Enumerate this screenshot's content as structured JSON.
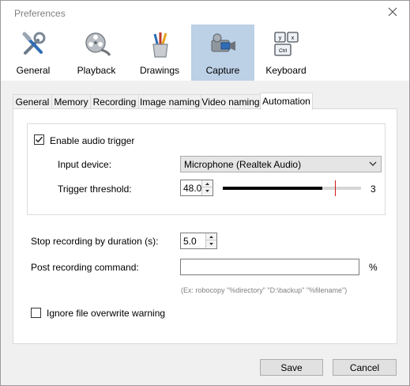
{
  "window": {
    "title": "Preferences"
  },
  "toolbar": {
    "items": [
      {
        "label": "General",
        "icon": "tools-icon"
      },
      {
        "label": "Playback",
        "icon": "film-reel-icon"
      },
      {
        "label": "Drawings",
        "icon": "pencil-cup-icon"
      },
      {
        "label": "Capture",
        "icon": "video-camera-icon",
        "active": true
      },
      {
        "label": "Keyboard",
        "icon": "keyboard-keys-icon"
      }
    ],
    "keys": {
      "k1": "y",
      "k2": "x",
      "k3": "Ctrl"
    }
  },
  "tabs": [
    "General",
    "Memory",
    "Recording",
    "Image naming",
    "Video naming",
    "Automation"
  ],
  "active_tab": "Automation",
  "automation": {
    "enable_audio_trigger": {
      "label": "Enable audio trigger",
      "checked": true
    },
    "input_device": {
      "label": "Input device:",
      "value": "Microphone (Realtek Audio)"
    },
    "trigger_threshold": {
      "label": "Trigger threshold:",
      "value": "48.0",
      "level_value": "3",
      "level_fraction": 0.72,
      "threshold_fraction": 0.81
    },
    "stop_duration": {
      "label": "Stop recording by duration (s):",
      "value": "5.0"
    },
    "post_command": {
      "label": "Post recording command:",
      "value": "",
      "suffix": "%",
      "hint": "(Ex: robocopy \"%directory\" \"D:\\backup\" \"%filename\")"
    },
    "ignore_overwrite": {
      "label": "Ignore file overwrite warning",
      "checked": false
    }
  },
  "buttons": {
    "save": "Save",
    "cancel": "Cancel"
  },
  "colors": {
    "active_tool_bg": "#bcd0e6",
    "threshold_marker": "#d01818"
  }
}
